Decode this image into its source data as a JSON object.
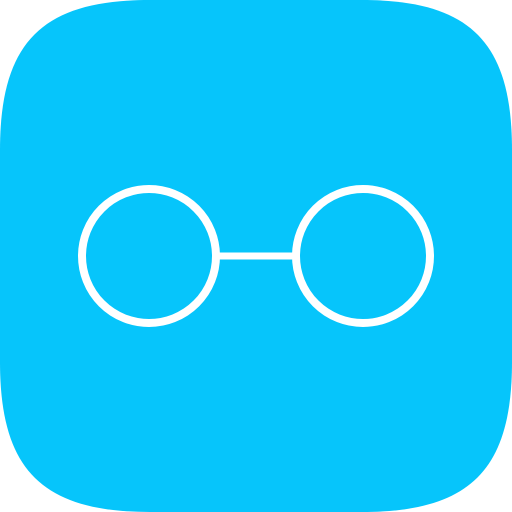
{
  "icon": {
    "name": "reading-glasses-icon",
    "background_color": "#06C5FB",
    "glyph_color": "#FFFFFF"
  }
}
